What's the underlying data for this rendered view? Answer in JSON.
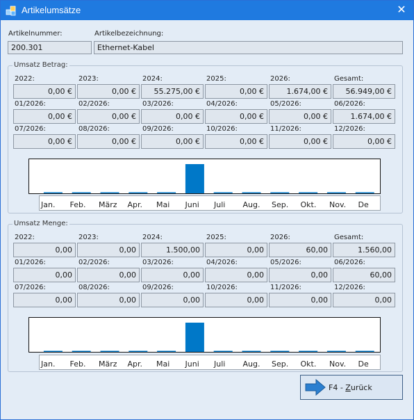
{
  "window": {
    "title": "Artikelumsätze",
    "close_glyph": "✕",
    "icon": "app-cubes-icon"
  },
  "article": {
    "number_label": "Artikelnummer:",
    "number": "200.301",
    "name_label": "Artikelbezeichnung:",
    "name": "Ethernet-Kabel"
  },
  "betrag": {
    "title": "Umsatz Betrag:",
    "years": [
      {
        "label": "2022:",
        "value": "0,00 €"
      },
      {
        "label": "2023:",
        "value": "0,00 €"
      },
      {
        "label": "2024:",
        "value": "55.275,00 €"
      },
      {
        "label": "2025:",
        "value": "0,00 €"
      },
      {
        "label": "2026:",
        "value": "1.674,00 €"
      },
      {
        "label": "Gesamt:",
        "value": "56.949,00 €"
      }
    ],
    "months1": [
      {
        "label": "01/2026:",
        "value": "0,00 €"
      },
      {
        "label": "02/2026:",
        "value": "0,00 €"
      },
      {
        "label": "03/2026:",
        "value": "0,00 €"
      },
      {
        "label": "04/2026:",
        "value": "0,00 €"
      },
      {
        "label": "05/2026:",
        "value": "0,00 €"
      },
      {
        "label": "06/2026:",
        "value": "1.674,00 €"
      }
    ],
    "months2": [
      {
        "label": "07/2026:",
        "value": "0,00 €"
      },
      {
        "label": "08/2026:",
        "value": "0,00 €"
      },
      {
        "label": "09/2026:",
        "value": "0,00 €"
      },
      {
        "label": "10/2026:",
        "value": "0,00 €"
      },
      {
        "label": "11/2026:",
        "value": "0,00 €"
      },
      {
        "label": "12/2026:",
        "value": "0,00 €"
      }
    ]
  },
  "menge": {
    "title": "Umsatz Menge:",
    "years": [
      {
        "label": "2022:",
        "value": "0,00"
      },
      {
        "label": "2023:",
        "value": "0,00"
      },
      {
        "label": "2024:",
        "value": "1.500,00"
      },
      {
        "label": "2025:",
        "value": "0,00"
      },
      {
        "label": "2026:",
        "value": "60,00"
      },
      {
        "label": "Gesamt:",
        "value": "1.560,00"
      }
    ],
    "months1": [
      {
        "label": "01/2026:",
        "value": "0,00"
      },
      {
        "label": "02/2026:",
        "value": "0,00"
      },
      {
        "label": "03/2026:",
        "value": "0,00"
      },
      {
        "label": "04/2026:",
        "value": "0,00"
      },
      {
        "label": "05/2026:",
        "value": "0,00"
      },
      {
        "label": "06/2026:",
        "value": "60,00"
      }
    ],
    "months2": [
      {
        "label": "07/2026:",
        "value": "0,00"
      },
      {
        "label": "08/2026:",
        "value": "0,00"
      },
      {
        "label": "09/2026:",
        "value": "0,00"
      },
      {
        "label": "10/2026:",
        "value": "0,00"
      },
      {
        "label": "11/2026:",
        "value": "0,00"
      },
      {
        "label": "12/2026:",
        "value": "0,00"
      }
    ]
  },
  "chart_data": [
    {
      "type": "bar",
      "categories": [
        "Jan.",
        "Feb.",
        "März",
        "Apr.",
        "Mai",
        "Juni",
        "Juli",
        "Aug.",
        "Sep.",
        "Okt.",
        "Nov.",
        "De"
      ],
      "values": [
        0,
        0,
        0,
        0,
        0,
        1674,
        0,
        0,
        0,
        0,
        0,
        0
      ],
      "title": "",
      "xlabel": "",
      "ylabel": "",
      "bar_color": "#0078c8"
    },
    {
      "type": "bar",
      "categories": [
        "Jan.",
        "Feb.",
        "März",
        "Apr.",
        "Mai",
        "Juni",
        "Juli",
        "Aug.",
        "Sep.",
        "Okt.",
        "Nov.",
        "De"
      ],
      "values": [
        0,
        0,
        0,
        0,
        0,
        60,
        0,
        0,
        0,
        0,
        0,
        0
      ],
      "title": "",
      "xlabel": "",
      "ylabel": "",
      "bar_color": "#0078c8"
    }
  ],
  "back_button": {
    "prefix": "F4 - ",
    "underlined": "Z",
    "rest": "urück",
    "icon": "arrow-right-icon"
  }
}
